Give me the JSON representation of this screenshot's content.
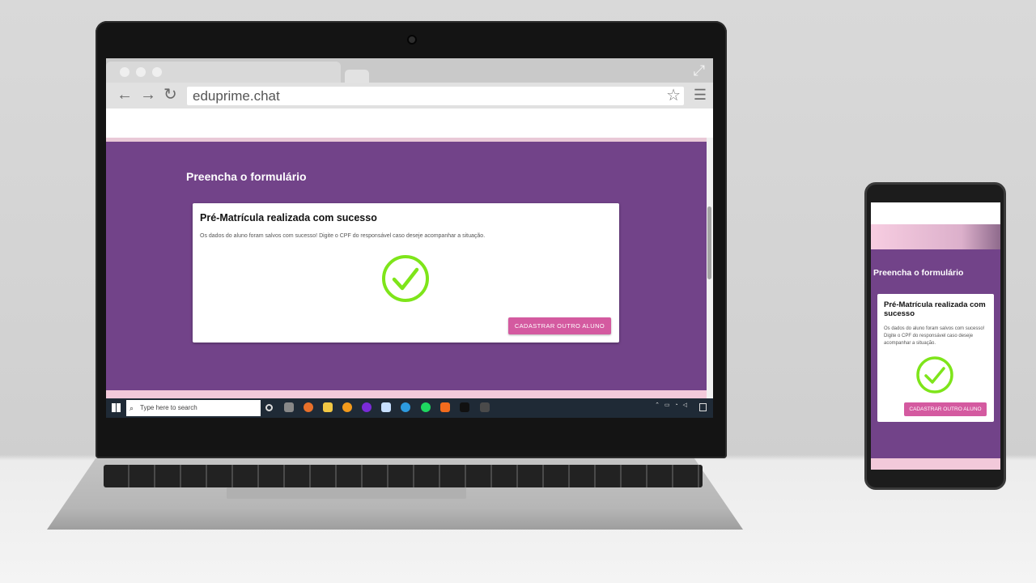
{
  "browser": {
    "url": "eduprime.chat"
  },
  "form": {
    "page_title": "Preencha o formulário",
    "card_title": "Pré-Matrícula realizada com sucesso",
    "card_message": "Os dados do aluno foram salvos com sucesso! Digite o CPF do responsável caso deseje acompanhar a situação.",
    "button_label": "CADASTRAR OUTRO ALUNO",
    "success_icon": "check-circle-icon",
    "success_color": "#7ee51a",
    "accent_color": "#d45aa0",
    "background_color": "#724389"
  },
  "taskbar": {
    "search_placeholder": "Type here to search"
  },
  "phone": {
    "page_title": "Preencha o formulário",
    "card_title": "Pré-Matrícula realizada com sucesso",
    "card_message": "Os dados do aluno foram salvos com sucesso! Digite o CPF do responsável caso deseje acompanhar a situação.",
    "button_label": "CADASTRAR OUTRO ALUNO"
  }
}
